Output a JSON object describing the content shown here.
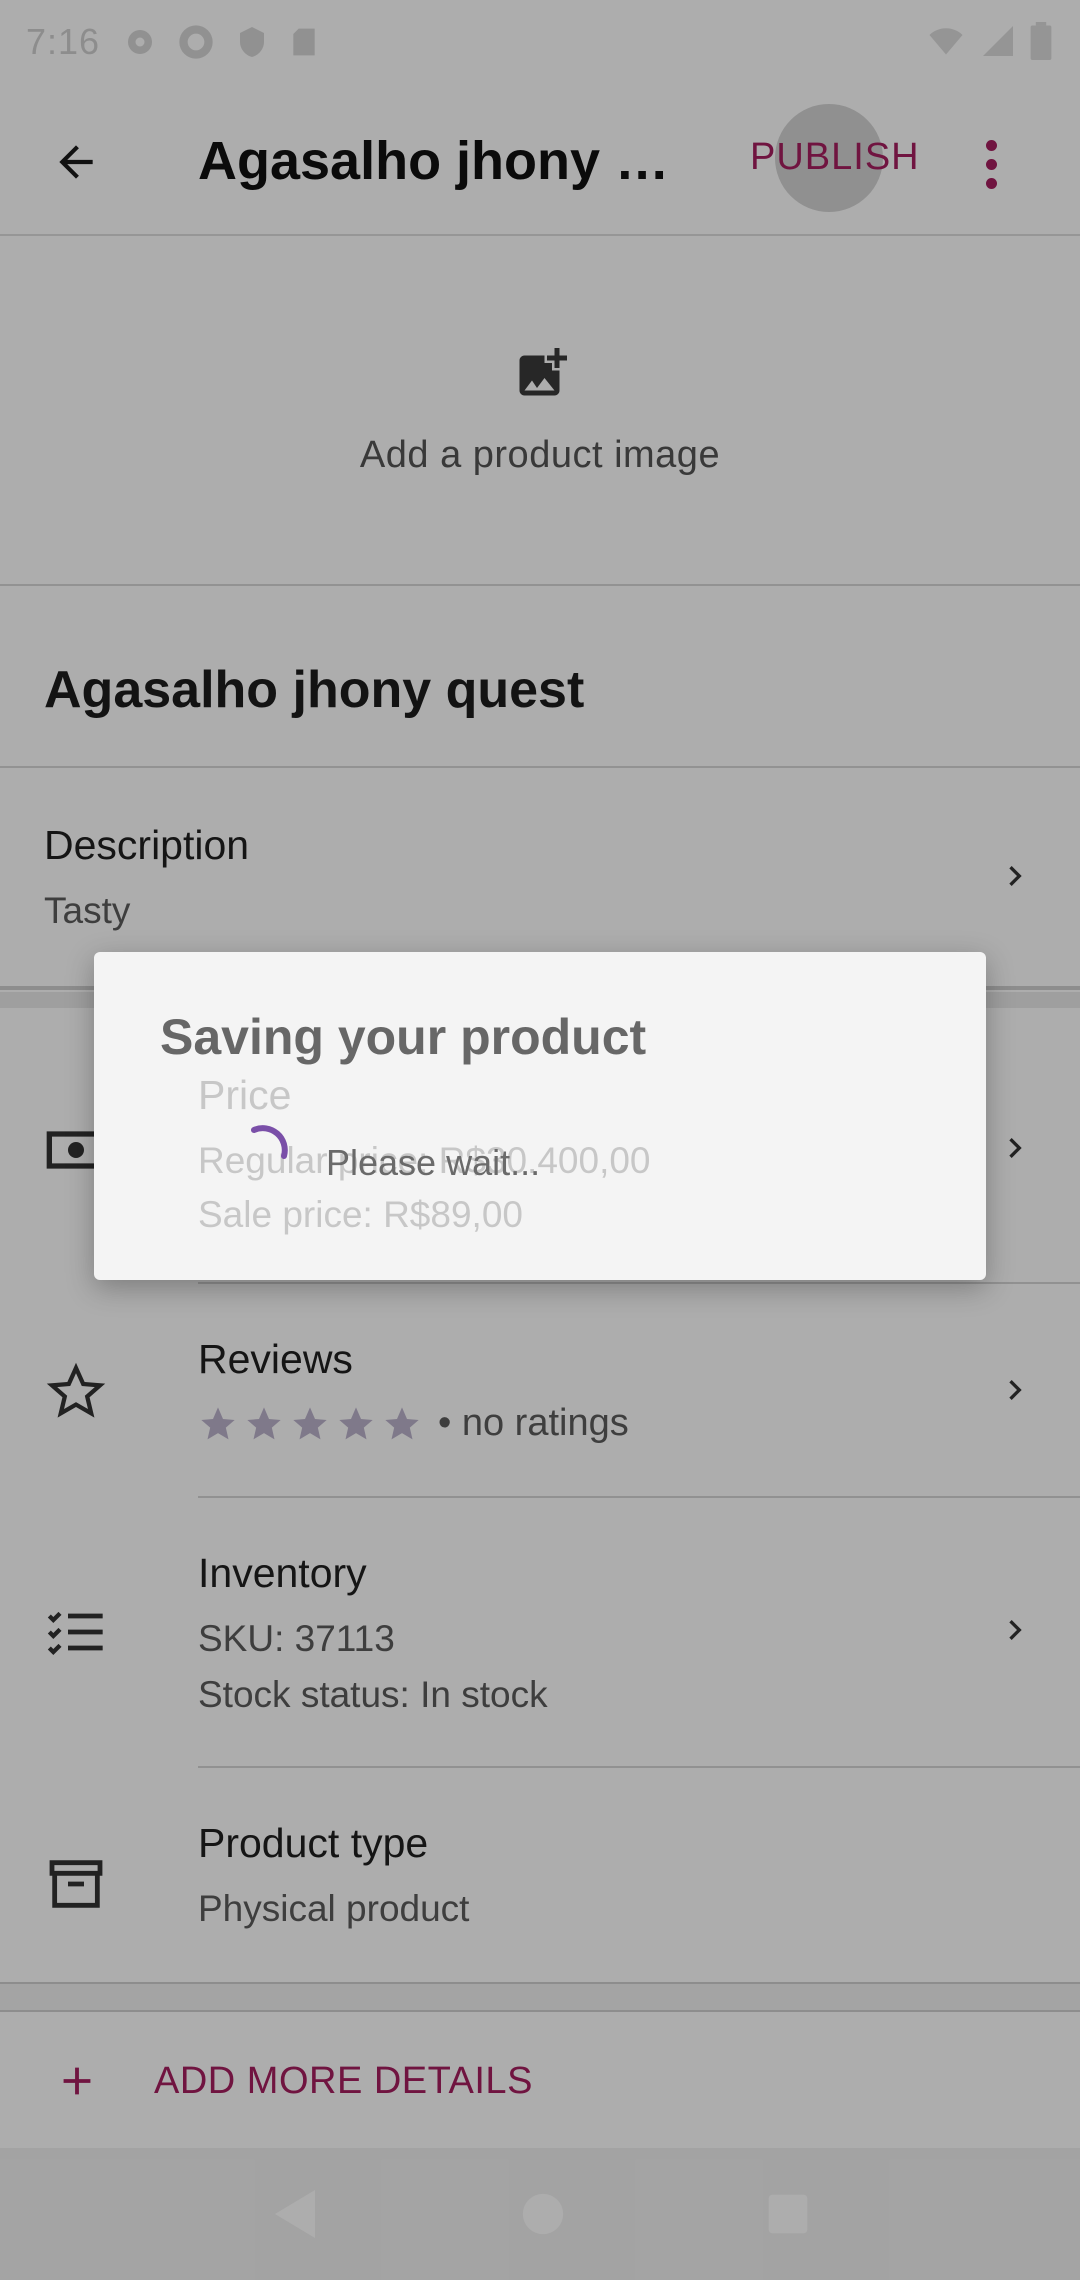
{
  "status_bar": {
    "time": "7:16"
  },
  "app_bar": {
    "title": "Agasalho jhony q…",
    "publish_label": "PUBLISH"
  },
  "image_section": {
    "add_image_label": "Add a product image"
  },
  "product": {
    "name": "Agasalho jhony quest"
  },
  "description": {
    "title": "Description",
    "value": "Tasty"
  },
  "price": {
    "title": "Price",
    "regular": "Regular price: R$30.400,00",
    "sale": "Sale price: R$89,00"
  },
  "reviews": {
    "title": "Reviews",
    "rating_stars": 0,
    "max_stars": 5,
    "ratings_text": "• no ratings"
  },
  "inventory": {
    "title": "Inventory",
    "sku": "SKU: 37113",
    "stock": "Stock status: In stock"
  },
  "product_type": {
    "title": "Product type",
    "value": "Physical product"
  },
  "add_more": {
    "label": "ADD MORE DETAILS"
  },
  "dialog": {
    "title": "Saving your product",
    "message": "Please wait..."
  },
  "colors": {
    "accent": "#a51e5f",
    "spinner": "#7a4fa8",
    "star": "#bcb3cc"
  }
}
